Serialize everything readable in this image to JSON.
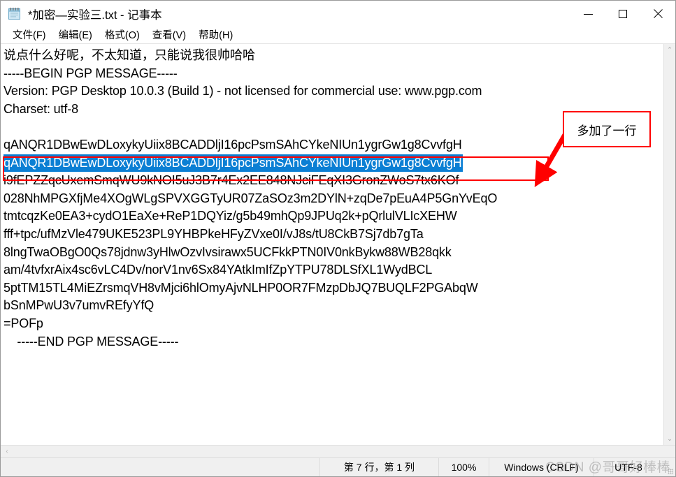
{
  "window": {
    "title": "*加密—实验三.txt - 记事本",
    "icon": "notepad-icon",
    "controls": {
      "minimize": "—",
      "maximize": "□",
      "close": "✕"
    }
  },
  "menubar": {
    "items": [
      {
        "label": "文件(F)",
        "name": "menu-file"
      },
      {
        "label": "编辑(E)",
        "name": "menu-edit"
      },
      {
        "label": "格式(O)",
        "name": "menu-format"
      },
      {
        "label": "查看(V)",
        "name": "menu-view"
      },
      {
        "label": "帮助(H)",
        "name": "menu-help"
      }
    ]
  },
  "document": {
    "lines": [
      {
        "text": "说点什么好呢，不太知道，只能说我很帅哈哈",
        "selected": false,
        "zh": true
      },
      {
        "text": "-----BEGIN PGP MESSAGE-----",
        "selected": false
      },
      {
        "text": "Version: PGP Desktop 10.0.3 (Build 1) - not licensed for commercial use: www.pgp.com",
        "selected": false
      },
      {
        "text": "Charset: utf-8",
        "selected": false
      },
      {
        "text": "",
        "selected": false
      },
      {
        "text": "qANQR1DBwEwDLoxykyUiix8BCADDljI16pcPsmSAhCYkeNIUn1ygrGw1g8CvvfgH",
        "selected": false
      },
      {
        "text": "qANQR1DBwEwDLoxykyUiix8BCADDljI16pcPsmSAhCYkeNIUn1ygrGw1g8CvvfgH",
        "selected": true
      },
      {
        "text": "i9fEPZZqcUxemSmqWU9kNOI5uJ3B7r4Ex2EE848NJciFEqXI3GronZWoS7tx6KOf",
        "selected": false
      },
      {
        "text": "028NhMPGXfjMe4XOgWLgSPVXGGTyUR07ZaSOz3m2DYlN+zqDe7pEuA4P5GnYvEqO",
        "selected": false
      },
      {
        "text": "tmtcqzKe0EA3+cydO1EaXe+ReP1DQYiz/g5b49mhQp9JPUq2k+pQrlulVLIcXEHW",
        "selected": false
      },
      {
        "text": "fff+tpc/ufMzVle479UKE523PL9YHBPkeHFyZVxe0I/vJ8s/tU8CkB7Sj7db7gTa",
        "selected": false
      },
      {
        "text": "8lngTwaOBgO0Qs78jdnw3yHlwOzvIvsirawx5UCFkkPTN0IV0nkBykw88WB28qkk",
        "selected": false
      },
      {
        "text": "am/4tvfxrAix4sc6vLC4Dv/norV1nv6Sx84YAtkImIfZpYTPU78DLSfXL1WydBCL",
        "selected": false
      },
      {
        "text": "5ptTM15TL4MiEZrsmqVH8vMjci6hlOmyAjvNLHP0OR7FMzpDbJQ7BUQLF2PGAbqW",
        "selected": false
      },
      {
        "text": "bSnMPwU3v7umvREfyYfQ",
        "selected": false
      },
      {
        "text": "=POFp",
        "selected": false
      },
      {
        "text": "    -----END PGP MESSAGE-----",
        "selected": false
      }
    ]
  },
  "scrollbars": {
    "vertical": {
      "up_arrow": "⌃",
      "down_arrow": "⌄"
    },
    "horizontal": {
      "left_arrow": "‹",
      "right_arrow": "›"
    }
  },
  "statusbar": {
    "position": "第 7 行，第 1 列",
    "zoom": "100%",
    "line_ending": "Windows (CRLF)",
    "encoding": "UTF-8"
  },
  "annotations": {
    "label": "多加了一行",
    "color": "#ff0000"
  },
  "watermark": {
    "text": "CSDN @哥哥好棒棒"
  }
}
